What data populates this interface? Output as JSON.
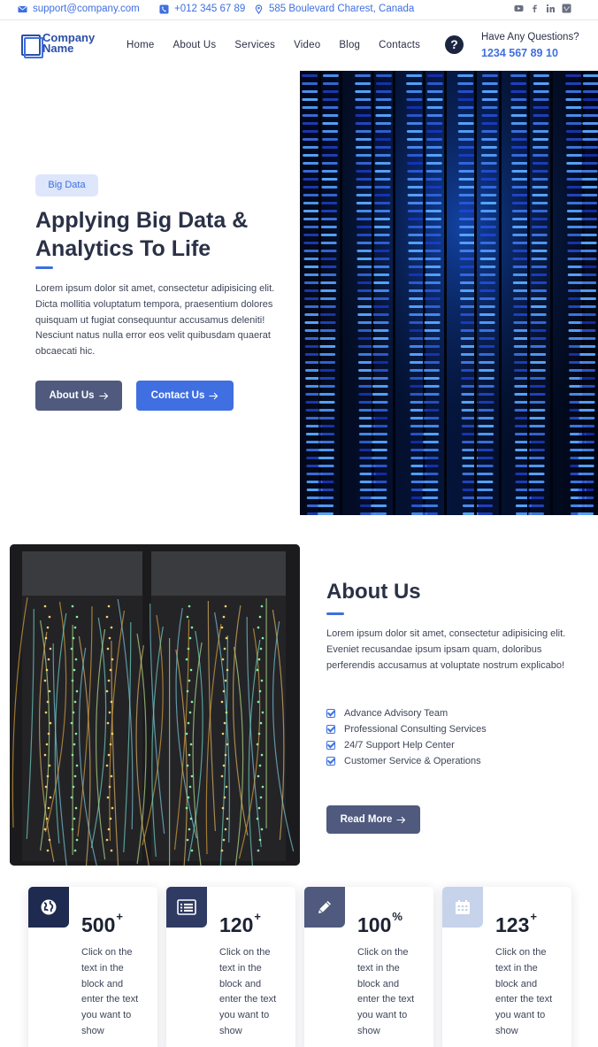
{
  "topbar": {
    "email": "support@company.com",
    "phone": "+012 345 67 89",
    "address": "585 Boulevard Charest, Canada",
    "social_icons": [
      "youtube-icon",
      "facebook-icon",
      "linkedin-icon",
      "vimeo-icon"
    ]
  },
  "header": {
    "logo_line1": "Company",
    "logo_line2": "Name",
    "nav": [
      "Home",
      "About Us",
      "Services",
      "Video",
      "Blog",
      "Contacts"
    ],
    "question_label": "Have Any Questions?",
    "question_phone": "1234 567 89 10"
  },
  "hero": {
    "badge": "Big Data",
    "title_line1": "Applying Big Data &",
    "title_line2": "Analytics To Life",
    "text": "Lorem ipsum dolor sit amet, consectetur adipisicing elit. Dicta mollitia voluptatum tempora, praesentium dolores quisquam ut fugiat consequuntur accusamus deleniti! Nesciunt natus nulla error eos velit quibusdam quaerat obcaecati hic.",
    "btn_about": "About Us",
    "btn_contact": "Contact Us"
  },
  "about": {
    "title": "About Us",
    "text": "Lorem ipsum dolor sit amet, consectetur adipisicing elit. Eveniet recusandae ipsum ipsam quam, doloribus perferendis accusamus at voluptate nostrum explicabo!",
    "items": [
      "Advance Advisory Team",
      "Professional Consulting Services",
      "24/7 Support Help Center",
      "Customer Service & Operations"
    ],
    "btn_read": "Read More"
  },
  "stats": [
    {
      "value": "500",
      "suffix": "+",
      "text": "Click on the text in the block and enter the text you want to show",
      "icon": "globe-icon",
      "icon_bg": "#1e2a4f"
    },
    {
      "value": "120",
      "suffix": "+",
      "text": "Click on the text in the block and enter the text you want to show",
      "icon": "list-icon",
      "icon_bg": "#2f3b63"
    },
    {
      "value": "100",
      "suffix": "%",
      "text": "Click on the text in the block and enter the text you want to show",
      "icon": "pencil-icon",
      "icon_bg": "#4f5a7e"
    },
    {
      "value": "123",
      "suffix": "+",
      "text": "Click on the text in the block and enter the text you want to show",
      "icon": "calendar-icon",
      "icon_bg": "#c6d3ea"
    }
  ],
  "colors": {
    "accent": "#3f6fe0",
    "dark": "#2a3146",
    "button_dark": "#4f5a7e"
  }
}
